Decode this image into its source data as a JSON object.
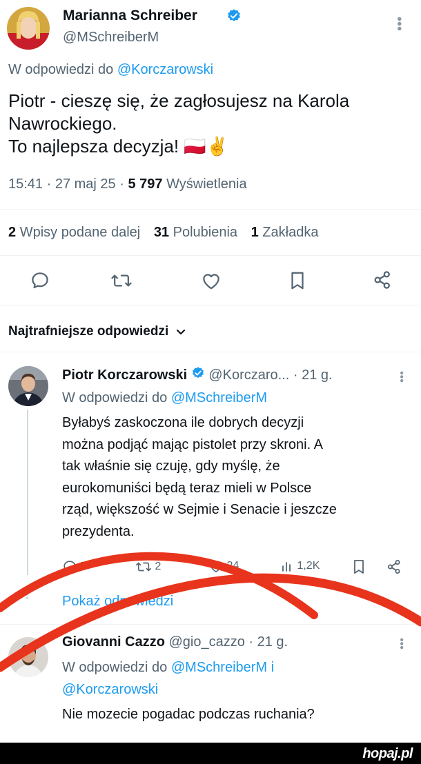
{
  "main_tweet": {
    "author_name": "Marianna Schreiber",
    "author_handle": "@MSchreiberM",
    "reply_prefix": "W odpowiedzi do",
    "reply_to": "@Korczarowski",
    "text_line1": "Piotr - cieszę się, że zagłosujesz na Karola",
    "text_line2": "Nawrockiego.",
    "text_line3": "To najlepsza decyzja! 🇵🇱✌️",
    "time": "15:41 · 27 maj 25 ·",
    "views_count": "5 797",
    "views_label": "Wyświetlenia",
    "reposts_count": "2",
    "reposts_label": "Wpisy podane dalej",
    "likes_count": "31",
    "likes_label": "Polubienia",
    "bookmarks_count": "1",
    "bookmarks_label": "Zakładka"
  },
  "replies_section": {
    "title": "Najtrafniejsze odpowiedzi"
  },
  "reply1": {
    "author_name": "Piotr Korczarowski",
    "author_handle": "@Korczaro...",
    "time": "· 21 g.",
    "reply_prefix": "W odpowiedzi do",
    "reply_to": "@MSchreiberM",
    "lines": [
      "Byłabyś zaskoczona ile dobrych decyzji",
      "można podjąć mając pistolet przy skroni. A",
      "tak właśnie się czuję, gdy myślę, że",
      "eurokomuniści będą teraz mieli w Polsce",
      "rząd, większość w Sejmie i Senacie i jeszcze",
      "prezydenta."
    ],
    "reply_count": "7",
    "repost_count": "2",
    "like_count": "24",
    "view_count": "1,2K",
    "show_replies": "Pokaż odpowiedzi"
  },
  "reply2": {
    "author_name": "Giovanni Cazzo",
    "author_handle": "@gio_cazzo",
    "time": "· 21 g.",
    "reply_prefix": "W odpowiedzi do",
    "reply_to_1": "@MSchreiberM i",
    "reply_to_2": "@Korczarowski",
    "text": "Nie mozecie pogadac podczas ruchania?"
  },
  "watermark": "hopaj.pl",
  "colors": {
    "link": "#1d9bf0",
    "muted": "#536471",
    "annotation_red": "#e8341c",
    "footer": "#000000"
  }
}
